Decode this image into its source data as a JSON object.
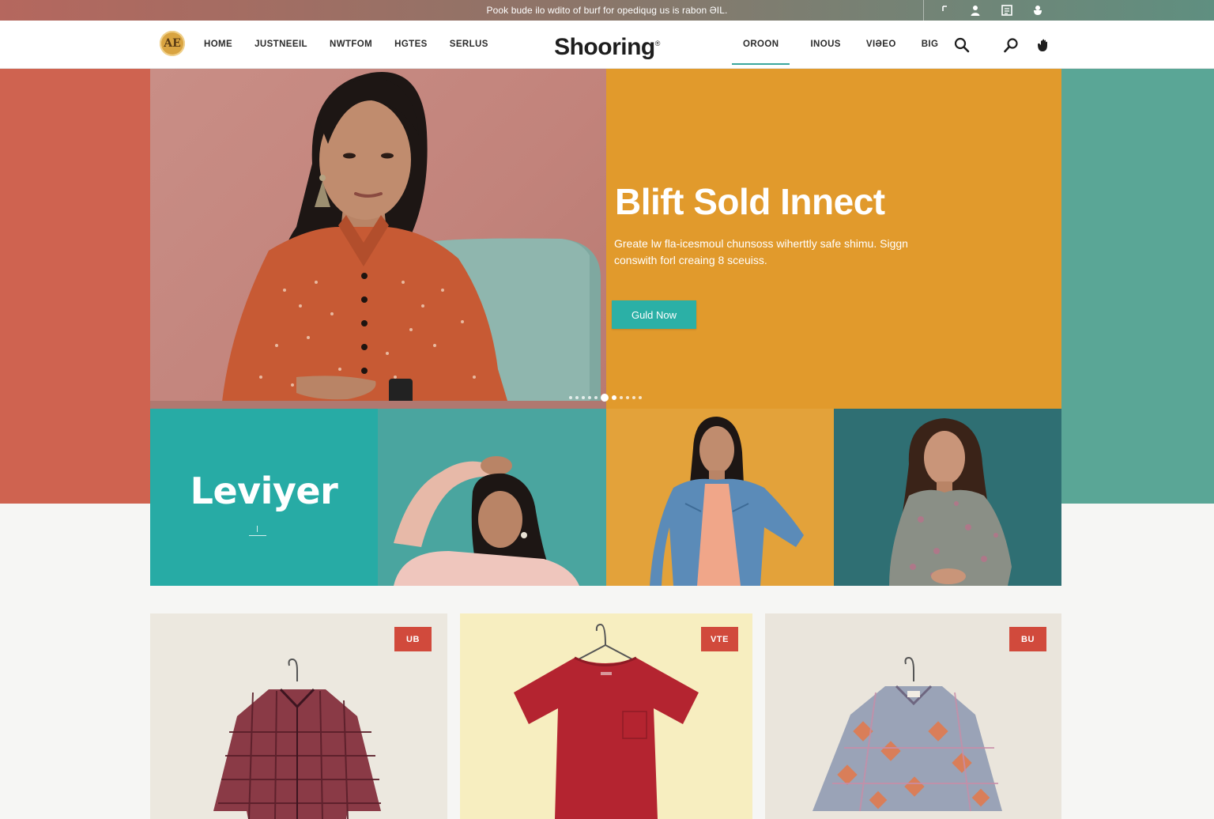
{
  "promo": {
    "text": "Pook bude ilo wdito of burf for opediqug us is rabon ƏIL."
  },
  "header": {
    "logo_text": "AE",
    "brand": "Shooring",
    "brand_mark": "®",
    "nav_left": [
      "HOME",
      "JUSTNEEIL",
      "NWTFOM",
      "HGTES",
      "SERLUS"
    ],
    "nav_right": [
      "OROON",
      "INOUS",
      "VIƏEO",
      "BIG"
    ]
  },
  "hero": {
    "title": "Blift Sold Innect",
    "subtitle": "Greate lw fla-icesmoul chunsoss wiherttly safe shimu. Siggn conswith forl creaing 8 sceuiss.",
    "cta_label": "Guld Now"
  },
  "tiles": {
    "brand_word": "Leviyer"
  },
  "products": [
    {
      "badge": "UB"
    },
    {
      "badge": "VTE"
    },
    {
      "badge": "BU"
    }
  ],
  "colors": {
    "accent_teal": "#2bb0a6",
    "hero_orange": "#e19a2c",
    "side_red": "#cf6350",
    "side_green": "#5aa696",
    "badge_red": "#d14a3c"
  },
  "icons": [
    "bookmark-icon",
    "user-icon",
    "list-icon",
    "hand-icon",
    "search-icon",
    "search-alt-icon",
    "hand-icon"
  ]
}
